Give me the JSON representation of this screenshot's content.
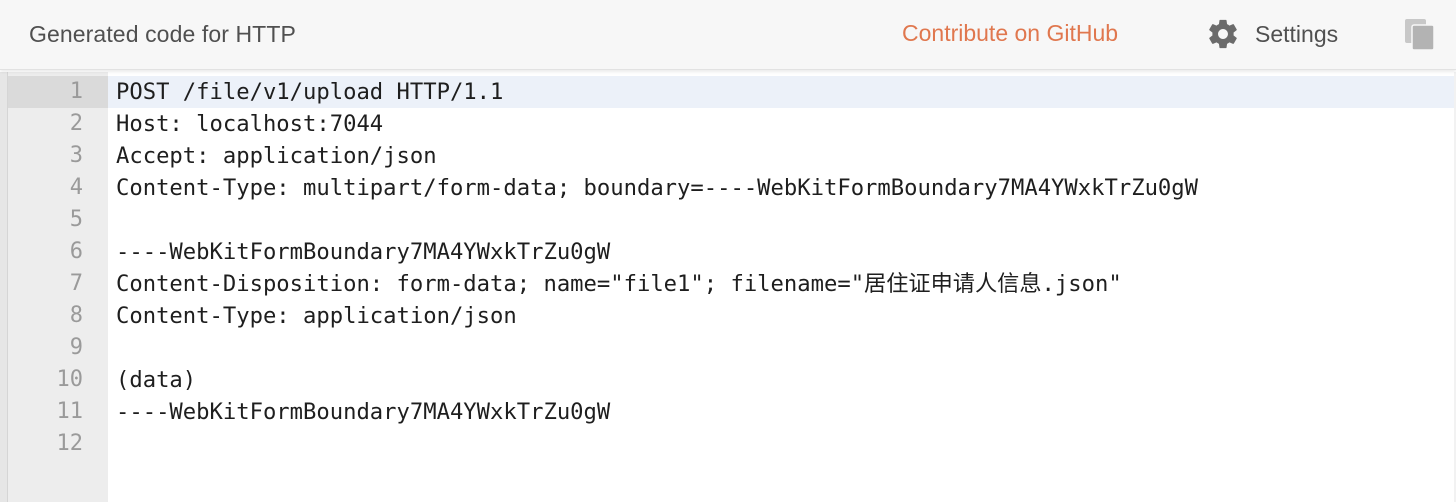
{
  "header": {
    "title": "Generated code for HTTP",
    "github_label": "Contribute on GitHub",
    "settings_label": "Settings",
    "settings_icon": "gear-icon",
    "copy_icon": "copy-icon"
  },
  "colors": {
    "accent": "#e0774e",
    "header_bg": "#f7f7f7",
    "gutter_bg": "#ededed",
    "active_line": "#ecf1f9"
  },
  "editor": {
    "active_line": 1,
    "lines": [
      {
        "number": "1",
        "text": "POST /file/v1/upload HTTP/1.1"
      },
      {
        "number": "2",
        "text": "Host: localhost:7044"
      },
      {
        "number": "3",
        "text": "Accept: application/json"
      },
      {
        "number": "4",
        "text": "Content-Type: multipart/form-data; boundary=----WebKitFormBoundary7MA4YWxkTrZu0gW"
      },
      {
        "number": "5",
        "text": ""
      },
      {
        "number": "6",
        "text": "----WebKitFormBoundary7MA4YWxkTrZu0gW"
      },
      {
        "number": "7",
        "text": "Content-Disposition: form-data; name=\"file1\"; filename=\"居住证申请人信息.json\""
      },
      {
        "number": "8",
        "text": "Content-Type: application/json"
      },
      {
        "number": "9",
        "text": ""
      },
      {
        "number": "10",
        "text": "(data)"
      },
      {
        "number": "11",
        "text": "----WebKitFormBoundary7MA4YWxkTrZu0gW"
      },
      {
        "number": "12",
        "text": ""
      }
    ]
  }
}
